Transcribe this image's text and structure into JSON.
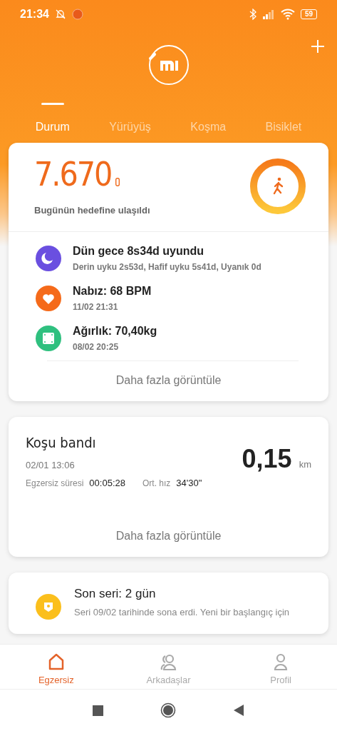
{
  "status_bar": {
    "time": "21:34",
    "battery": "59"
  },
  "tabs": [
    {
      "label": "Durum",
      "selected": true
    },
    {
      "label": "Yürüyüş",
      "selected": false
    },
    {
      "label": "Koşma",
      "selected": false
    },
    {
      "label": "Bisiklet",
      "selected": false
    }
  ],
  "steps": {
    "value": "7.670",
    "caption": "Bugünün hedefine ulaşıldı"
  },
  "metrics": [
    {
      "kind": "sleep",
      "color": "#6a4fe0",
      "title": "Dün gece 8s34d uyundu",
      "detail": "Derin uyku 2s53d, Hafif uyku 5s41d, Uyanık 0d"
    },
    {
      "kind": "heart",
      "color": "#f56a1a",
      "title": "Nabız: 68 BPM",
      "detail": "11/02 21:31"
    },
    {
      "kind": "weight",
      "color": "#2fc07f",
      "title": "Ağırlık: 70,40kg",
      "detail": "08/02 20:25"
    }
  ],
  "more_1": "Daha fazla görüntüle",
  "workout": {
    "title": "Koşu bandı",
    "date": "02/01 13:06",
    "duration_label": "Egzersiz süresi",
    "duration": "00:05:28",
    "pace_label": "Ort. hız",
    "pace": "34'30\"",
    "distance": "0,15",
    "unit": "km"
  },
  "more_2": "Daha fazla görüntüle",
  "streak": {
    "title": "Son seri: 2 gün",
    "detail": "Seri 09/02 tarihinde sona erdi. Yeni bir başlangıç için"
  },
  "bottom_nav": [
    {
      "kind": "home",
      "label": "Egzersiz",
      "selected": true
    },
    {
      "kind": "friends",
      "label": "Arkadaşlar",
      "selected": false
    },
    {
      "kind": "profile",
      "label": "Profil",
      "selected": false
    }
  ]
}
